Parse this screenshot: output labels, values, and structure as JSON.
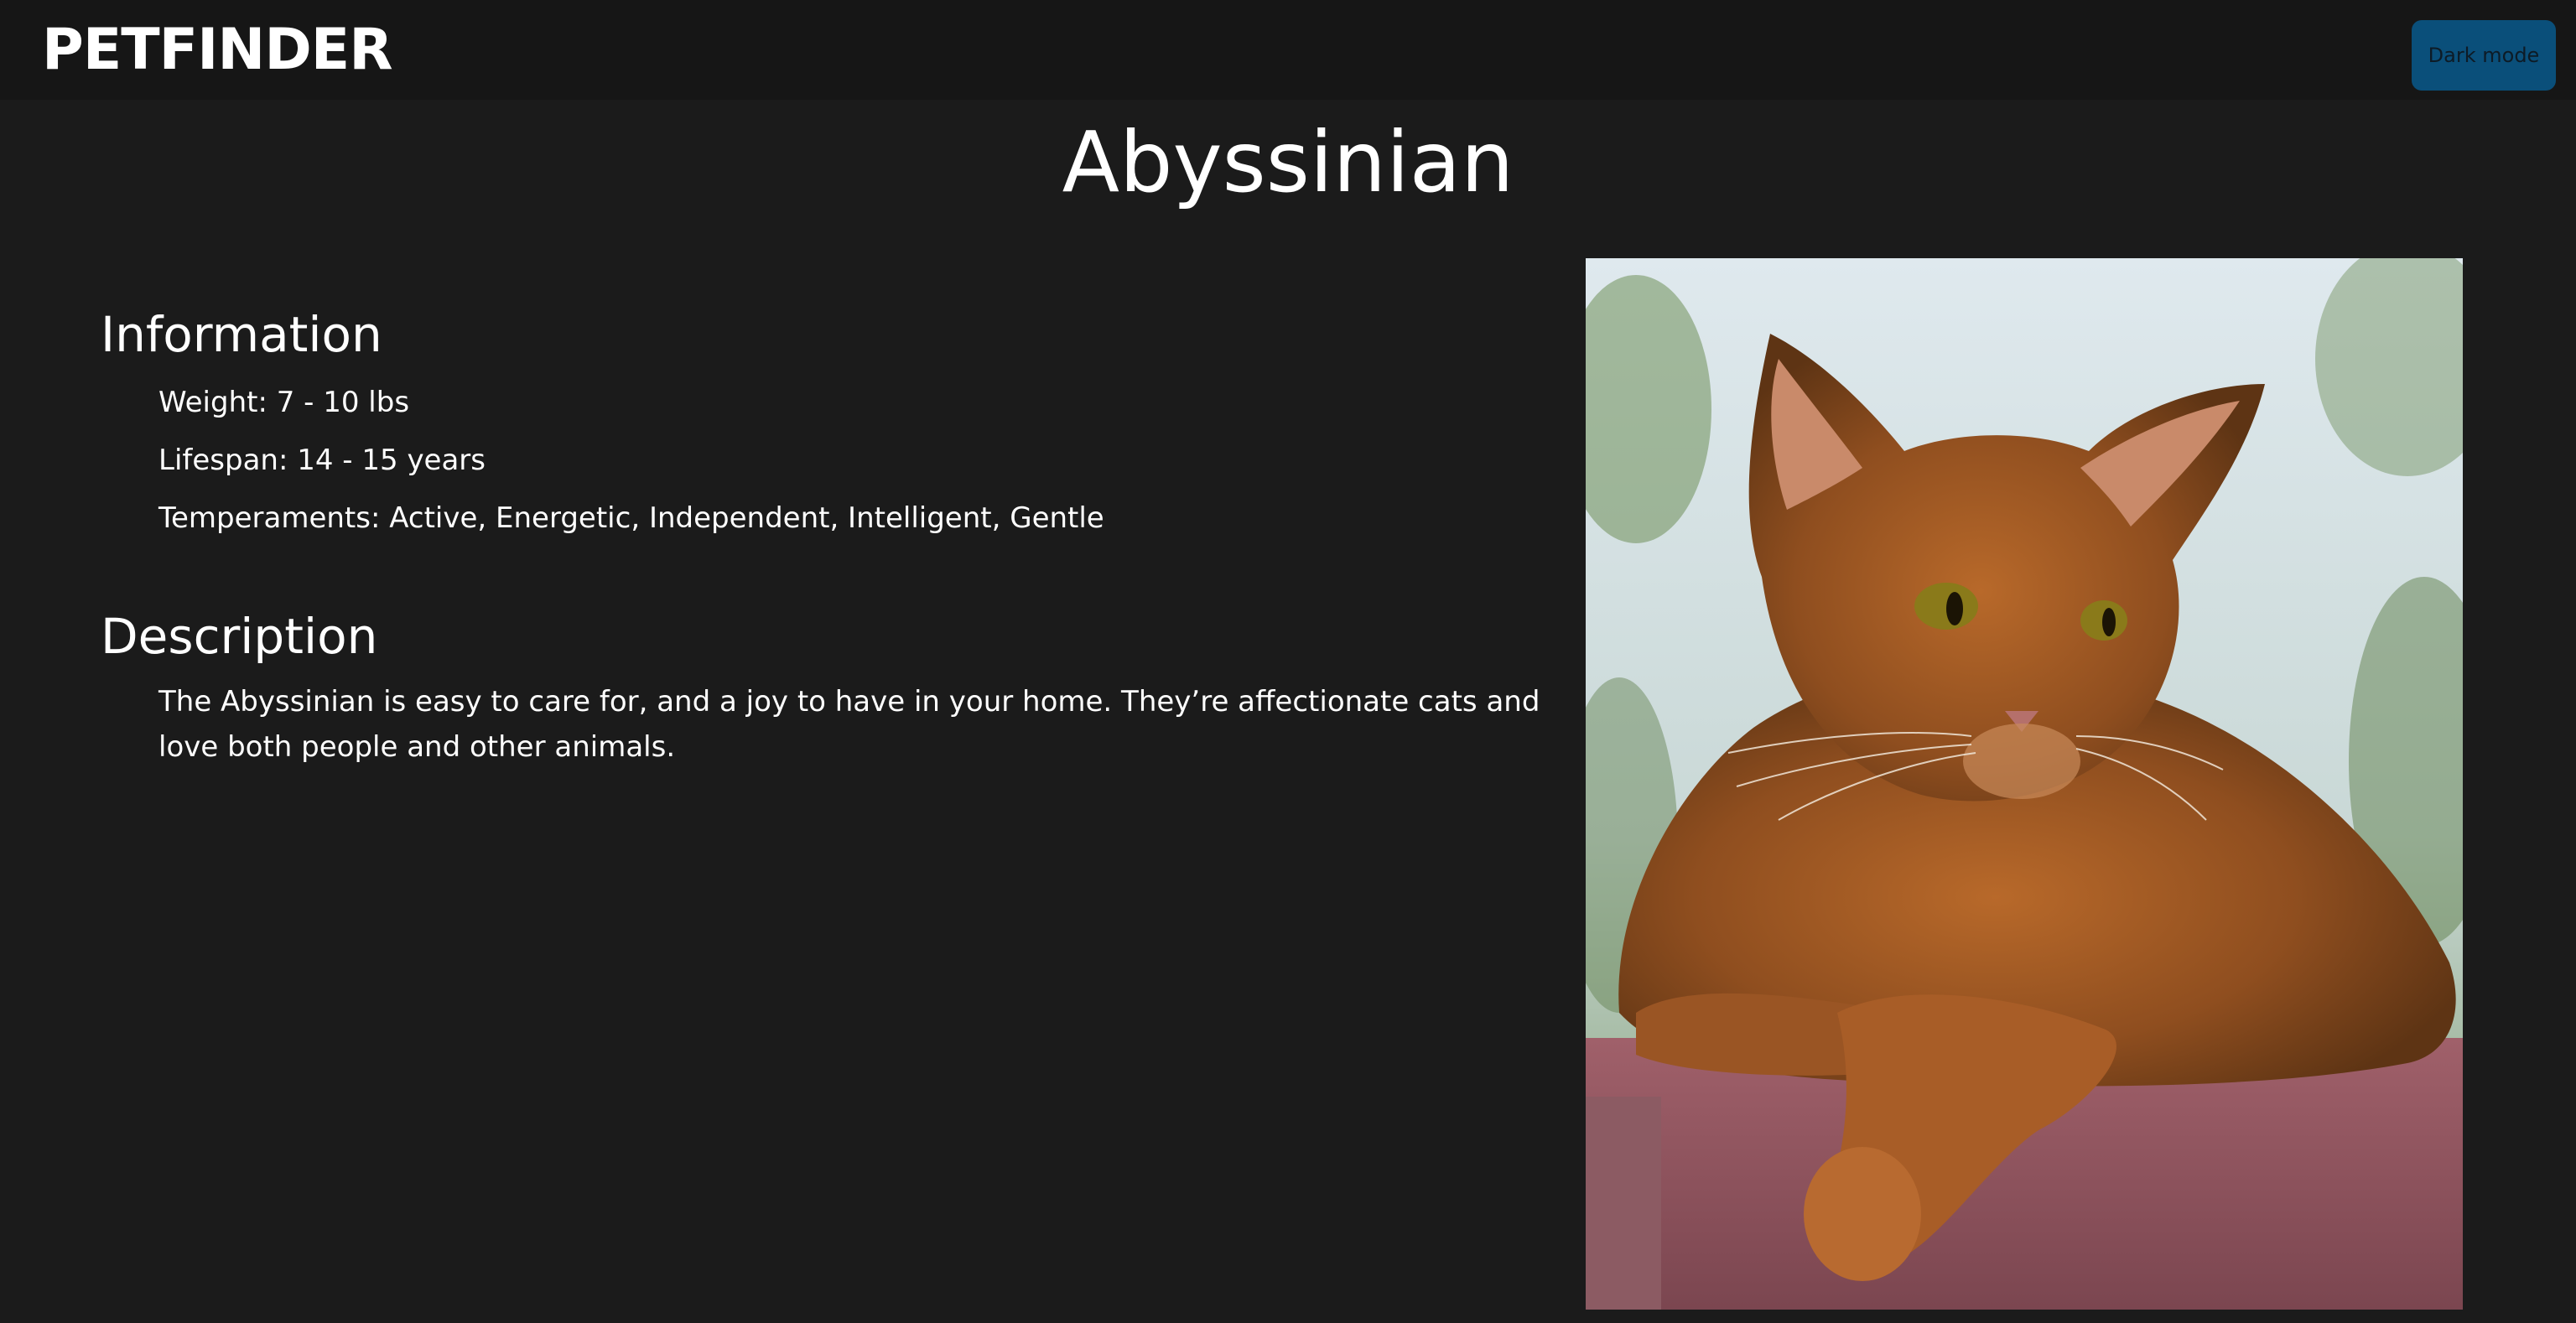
{
  "navbar": {
    "logo_text": "PETFINDER",
    "dark_mode_label": "Dark mode"
  },
  "breed": {
    "name": "Abyssinian",
    "photo_alt": "Abyssinian",
    "information": {
      "heading": "Information",
      "items": [
        "Weight: 7 - 10 lbs",
        "Lifespan: 14 - 15 years",
        "Temperaments: Active, Energetic, Independent, Intelligent, Gentle"
      ]
    },
    "description": {
      "heading": "Description",
      "text": "The Abyssinian is easy to care for, and a joy to have in your home. They’re affectionate cats and love both people and other animals."
    }
  },
  "colors": {
    "background": "#1b1b1b",
    "navbar": "#161616",
    "button": "#0a4f7a",
    "text": "#ffffff"
  }
}
